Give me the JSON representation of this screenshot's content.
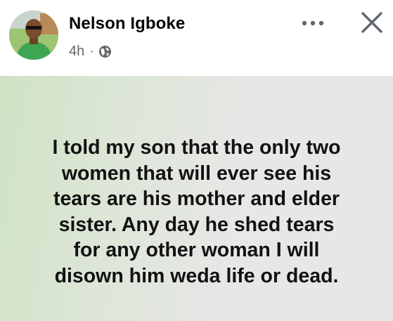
{
  "post": {
    "author": "Nelson Igboke",
    "time": "4h",
    "separator": "·",
    "privacy_icon": "globe-icon",
    "more_icon": "more-dots-icon",
    "close_icon": "close-icon",
    "text": "I told my son that the only two\nwomen that will ever see his\ntears are his mother and elder\nsister. Any day he shed tears\nfor any other woman I will\ndisown him weda life or dead.",
    "background_colors": [
      "#cfe3c4",
      "#e8e6e8"
    ]
  }
}
